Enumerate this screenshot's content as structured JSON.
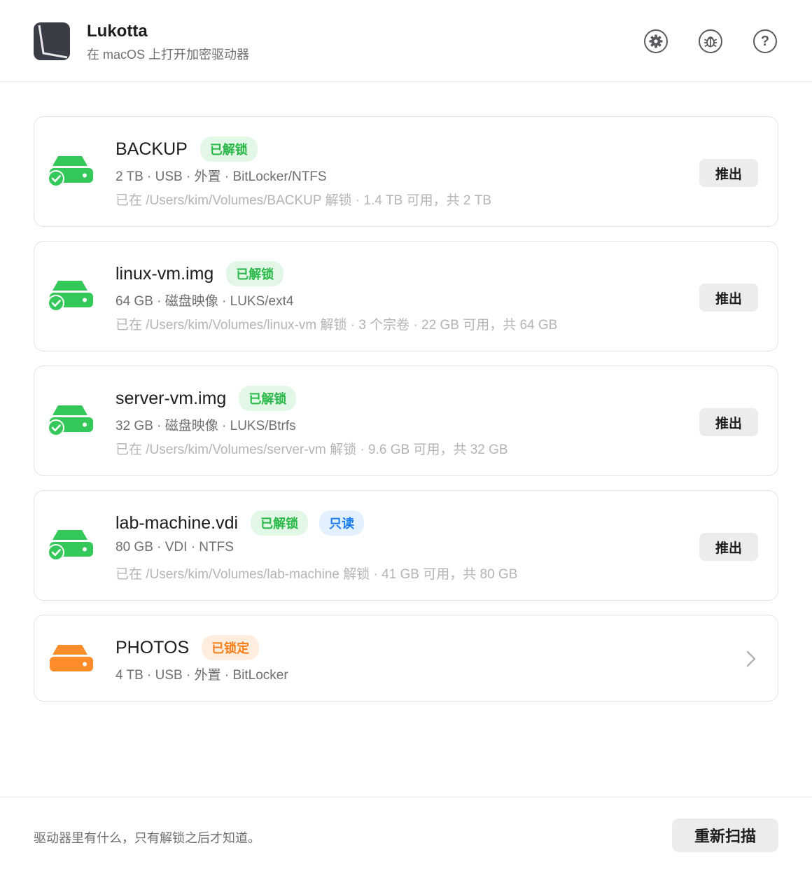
{
  "app": {
    "name": "Lukotta",
    "subtitle": "在 macOS 上打开加密驱动器"
  },
  "header_icons": [
    "settings-icon",
    "bug-icon",
    "help-icon"
  ],
  "help_glyph": "?",
  "drives": [
    {
      "name": "BACKUP",
      "badges": [
        {
          "text": "已解锁",
          "tone": "green"
        }
      ],
      "meta": "2 TB  ·  USB · 外置  ·  BitLocker/NTFS",
      "path": "已在 /Users/kim/Volumes/BACKUP 解锁  ·  1.4 TB 可用，共 2 TB",
      "action": "推出",
      "status_color": "#34c759"
    },
    {
      "name": "linux-vm.img",
      "badges": [
        {
          "text": "已解锁",
          "tone": "green"
        }
      ],
      "meta": "64 GB  ·  磁盘映像  ·  LUKS/ext4",
      "path": "已在 /Users/kim/Volumes/linux-vm 解锁  ·  3 个宗卷  ·  22 GB 可用，共 64 GB",
      "action": "推出",
      "status_color": "#34c759"
    },
    {
      "name": "server-vm.img",
      "badges": [
        {
          "text": "已解锁",
          "tone": "green"
        }
      ],
      "meta": "32 GB  ·  磁盘映像  ·  LUKS/Btrfs",
      "path": "已在 /Users/kim/Volumes/server-vm 解锁  ·  9.6 GB 可用，共 32 GB",
      "action": "推出",
      "status_color": "#34c759"
    },
    {
      "name": "lab-machine.vdi",
      "badges": [
        {
          "text": "已解锁",
          "tone": "green"
        },
        {
          "text": "只读",
          "tone": "blue"
        }
      ],
      "meta": "80 GB  ·  VDI  ·  NTFS",
      "path": "已在 /Users/kim/Volumes/lab-machine 解锁  ·  41 GB 可用，共 80 GB",
      "action": "推出",
      "status_color": "#34c759"
    },
    {
      "name": "PHOTOS",
      "badges": [
        {
          "text": "已锁定",
          "tone": "orange"
        }
      ],
      "meta": "4 TB  ·  USB · 外置  ·  BitLocker",
      "status_color": "#ff8c2a"
    }
  ],
  "footer": {
    "text": "驱动器里有什么，只有解锁之后才知道。",
    "rescan_label": "重新扫描"
  }
}
